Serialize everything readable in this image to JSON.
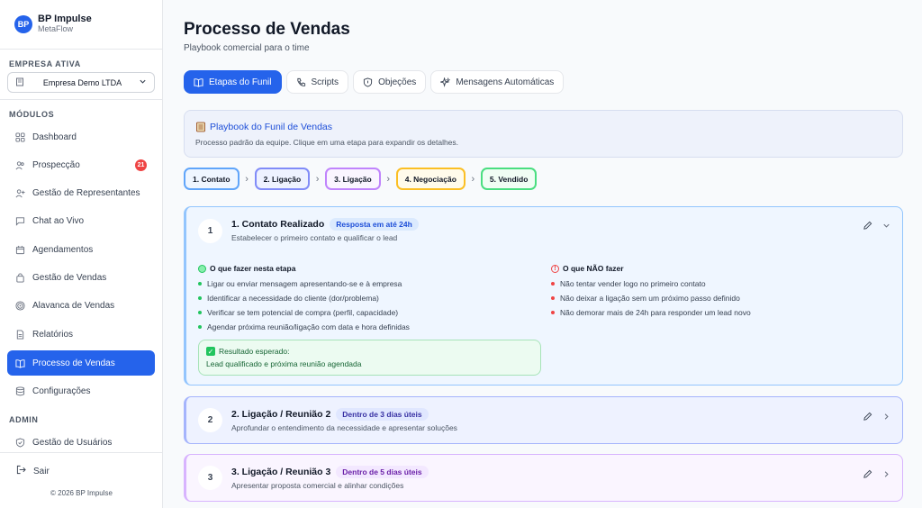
{
  "brand": {
    "initials": "BP",
    "name": "BP Impulse",
    "subtitle": "MetaFlow"
  },
  "sidebar": {
    "company_label": "EMPRESA ATIVA",
    "company_value": "Empresa Demo LTDA",
    "modules_label": "MÓDULOS",
    "admin_label": "ADMIN",
    "items": [
      {
        "label": "Dashboard",
        "icon": "grid-icon"
      },
      {
        "label": "Prospecção",
        "icon": "users-icon",
        "badge": "21"
      },
      {
        "label": "Gestão de Representantes",
        "icon": "user-plus-icon"
      },
      {
        "label": "Chat ao Vivo",
        "icon": "chat-icon"
      },
      {
        "label": "Agendamentos",
        "icon": "calendar-icon"
      },
      {
        "label": "Gestão de Vendas",
        "icon": "bag-icon"
      },
      {
        "label": "Alavanca de Vendas",
        "icon": "target-icon"
      },
      {
        "label": "Relatórios",
        "icon": "file-icon"
      },
      {
        "label": "Processo de Vendas",
        "icon": "book-icon",
        "active": true
      },
      {
        "label": "Configurações",
        "icon": "database-icon"
      }
    ],
    "admin_items": [
      {
        "label": "Gestão de Usuários",
        "icon": "shield-icon"
      }
    ],
    "logout": "Sair",
    "copyright": "© 2026 BP Impulse"
  },
  "header": {
    "title": "Processo de Vendas",
    "subtitle": "Playbook comercial para o time"
  },
  "tabs": [
    {
      "label": "Etapas do Funil",
      "icon": "book-icon",
      "active": true
    },
    {
      "label": "Scripts",
      "icon": "phone-icon"
    },
    {
      "label": "Objeções",
      "icon": "shield-icon"
    },
    {
      "label": "Mensagens Automáticas",
      "icon": "sparkle-icon"
    }
  ],
  "playbook": {
    "title": "Playbook do Funil de Vendas",
    "description": "Processo padrão da equipe. Clique em uma etapa para expandir os detalhes."
  },
  "steps": [
    {
      "label": "1. Contato",
      "color": "#60a5fa"
    },
    {
      "label": "2. Ligação",
      "color": "#818cf8"
    },
    {
      "label": "3. Ligação",
      "color": "#c084fc"
    },
    {
      "label": "4. Negociação",
      "color": "#fbbf24"
    },
    {
      "label": "5. Vendido",
      "color": "#4ade80"
    }
  ],
  "stages": [
    {
      "number": "1",
      "title": "1. Contato Realizado",
      "pill": "Resposta em até 24h",
      "description": "Estabelecer o primeiro contato e qualificar o lead",
      "do_title": "O que fazer nesta etapa",
      "do_items": [
        "Ligar ou enviar mensagem apresentando-se e à empresa",
        "Identificar a necessidade do cliente (dor/problema)",
        "Verificar se tem potencial de compra (perfil, capacidade)",
        "Agendar próxima reunião/ligação com data e hora definidas"
      ],
      "dont_title": "O que NÃO fazer",
      "dont_items": [
        "Não tentar vender logo no primeiro contato",
        "Não deixar a ligação sem um próximo passo definido",
        "Não demorar mais de 24h para responder um lead novo"
      ],
      "result_title": "Resultado esperado:",
      "result_text": "Lead qualificado e próxima reunião agendada"
    },
    {
      "number": "2",
      "title": "2. Ligação / Reunião 2",
      "pill": "Dentro de 3 dias úteis",
      "description": "Aprofundar o entendimento da necessidade e apresentar soluções"
    },
    {
      "number": "3",
      "title": "3. Ligação / Reunião 3",
      "pill": "Dentro de 5 dias úteis",
      "description": "Apresentar proposta comercial e alinhar condições"
    }
  ],
  "colors": {
    "accent": "#2563eb",
    "badge": "#ef4444",
    "success": "#22c55e",
    "danger": "#ef4444"
  }
}
